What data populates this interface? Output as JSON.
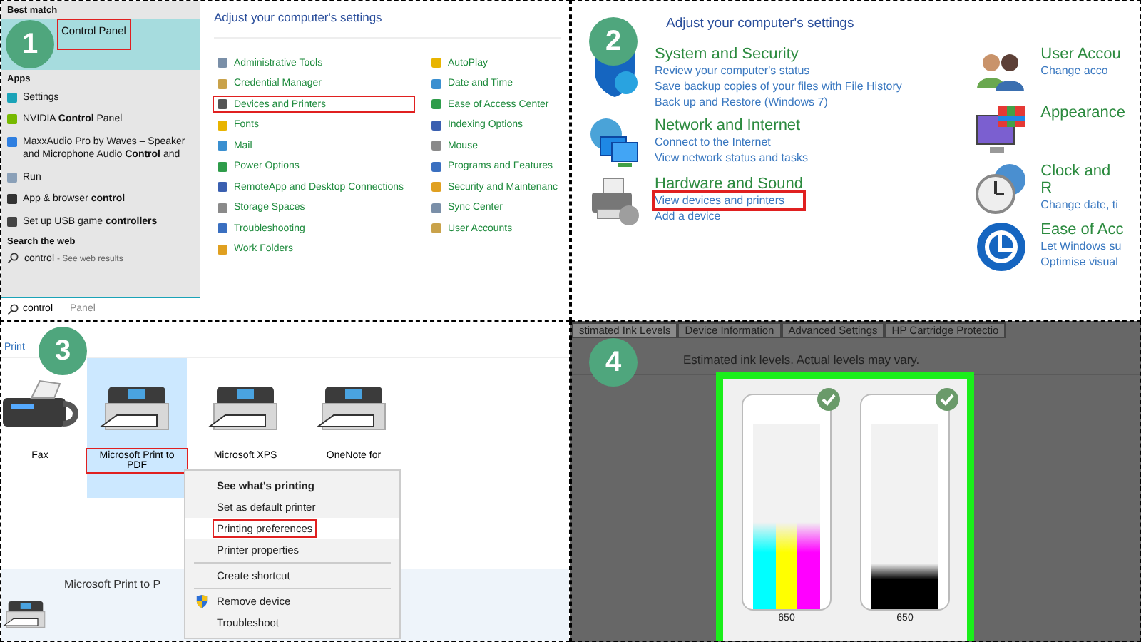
{
  "search_panel": {
    "step": "1",
    "best_match_heading": "Best match",
    "best_match": {
      "label": "Control Panel",
      "selected": true,
      "highlighted": true
    },
    "apps_heading": "Apps",
    "apps": [
      {
        "label": "Settings",
        "kind": "gear"
      },
      {
        "label": "NVIDIA **Control** Panel",
        "kind": "nvidia"
      },
      {
        "label": "MaxxAudio Pro by Waves – Speaker and Microphone Audio **Control** and",
        "kind": "audio"
      },
      {
        "label": "Run",
        "kind": "run"
      },
      {
        "label": "App & browser **control**",
        "kind": "shield"
      },
      {
        "label": "Set up USB game **controllers**",
        "kind": "gamepad"
      }
    ],
    "web_heading": "Search the web",
    "web_result": {
      "query": "control",
      "hint": "- See web results"
    },
    "search": {
      "value": "control",
      "suggestion": "Panel"
    }
  },
  "settings_panel": {
    "title": "Adjust your computer's settings",
    "columns": [
      {
        "items": [
          {
            "label": "Administrative Tools",
            "highlighted": false
          },
          {
            "label": "Credential Manager",
            "highlighted": false
          },
          {
            "label": "Devices and Printers",
            "highlighted": true
          },
          {
            "label": "Fonts",
            "highlighted": false
          },
          {
            "label": "Mail",
            "highlighted": false
          },
          {
            "label": "Power Options",
            "highlighted": false
          },
          {
            "label": "RemoteApp and Desktop Connections",
            "highlighted": false
          },
          {
            "label": "Storage Spaces",
            "highlighted": false
          },
          {
            "label": "Troubleshooting",
            "highlighted": false
          },
          {
            "label": "Work Folders",
            "highlighted": false
          }
        ]
      },
      {
        "items": [
          {
            "label": "AutoPlay",
            "highlighted": false
          },
          {
            "label": "Date and Time",
            "highlighted": false
          },
          {
            "label": "Ease of Access Center",
            "highlighted": false
          },
          {
            "label": "Indexing Options",
            "highlighted": false
          },
          {
            "label": "Mouse",
            "highlighted": false
          },
          {
            "label": "Programs and Features",
            "highlighted": false
          },
          {
            "label": "Security and Maintenanc",
            "highlighted": false
          },
          {
            "label": "Sync Center",
            "highlighted": false
          },
          {
            "label": "User Accounts",
            "highlighted": false
          }
        ]
      }
    ]
  },
  "category_panel": {
    "step": "2",
    "title": "Adjust your computer's settings",
    "columns": [
      {
        "categories": [
          {
            "kind": "security",
            "title": "System and Security",
            "links": [
              {
                "label": "Review your computer's status",
                "highlighted": false
              },
              {
                "label": "Save backup copies of your files with File History",
                "highlighted": false
              },
              {
                "label": "Back up and Restore (Windows 7)",
                "highlighted": false
              }
            ]
          },
          {
            "kind": "network",
            "title": "Network and Internet",
            "links": [
              {
                "label": "Connect to the Internet",
                "highlighted": false
              },
              {
                "label": "View network status and tasks",
                "highlighted": false
              }
            ]
          },
          {
            "kind": "hardware",
            "title": "Hardware and Sound",
            "links": [
              {
                "label": "View devices and printers",
                "highlighted": true
              },
              {
                "label": "Add a device",
                "highlighted": false
              }
            ]
          }
        ]
      },
      {
        "categories": [
          {
            "kind": "accounts",
            "title": "User Accou",
            "links": [
              {
                "label": "Change acco",
                "highlighted": false
              }
            ]
          },
          {
            "kind": "appearance",
            "title": "Appearance"
          },
          {
            "kind": "clock",
            "title": "Clock and R",
            "links": [
              {
                "label": "Change date, ti",
                "highlighted": false
              }
            ]
          },
          {
            "kind": "access",
            "title": "Ease of Acc",
            "links": [
              {
                "label": "Let Windows su",
                "highlighted": false
              },
              {
                "label": "Optimise visual",
                "highlighted": false
              }
            ]
          }
        ]
      }
    ]
  },
  "devices_panel": {
    "step": "3",
    "header": "Print",
    "devices": [
      {
        "label": "Fax",
        "kind": "fax",
        "selected": false,
        "highlighted": false
      },
      {
        "label": "Microsoft Print to PDF",
        "kind": "printer",
        "selected": true,
        "highlighted": true
      },
      {
        "label": "Microsoft XPS",
        "kind": "printer",
        "selected": false,
        "highlighted": false
      },
      {
        "label": "OneNote for",
        "kind": "printer",
        "selected": false,
        "highlighted": false
      }
    ],
    "menu": {
      "groups": [
        {
          "items": [
            {
              "label": "See what's printing",
              "kind": "plain",
              "bold": true,
              "selected": false,
              "highlighted": false
            },
            {
              "label": "Set as default printer",
              "kind": "plain",
              "bold": false,
              "selected": false,
              "highlighted": false
            },
            {
              "label": "Printing preferences",
              "kind": "plain",
              "bold": false,
              "selected": true,
              "highlighted": true
            },
            {
              "label": "Printer properties",
              "kind": "plain",
              "bold": false,
              "selected": false,
              "highlighted": false
            }
          ]
        },
        {
          "items": [
            {
              "label": "Create shortcut",
              "kind": "plain",
              "bold": false,
              "selected": false,
              "highlighted": false
            }
          ]
        },
        {
          "items": [
            {
              "label": "Remove device",
              "kind": "shield",
              "bold": false,
              "selected": false,
              "highlighted": false
            },
            {
              "label": "Troubleshoot",
              "kind": "plain",
              "bold": false,
              "selected": false,
              "highlighted": false
            }
          ]
        }
      ]
    },
    "details": {
      "label": "Microsoft Print to P"
    }
  },
  "ink_panel": {
    "step": "4",
    "tabs": [
      {
        "label": "stimated Ink Levels",
        "selected": true
      },
      {
        "label": "Device Information",
        "selected": false
      },
      {
        "label": "Advanced Settings",
        "selected": false
      },
      {
        "label": "HP Cartridge Protectio",
        "selected": false
      }
    ],
    "note": "Estimated ink levels.  Actual levels may vary.",
    "cartridges": [
      {
        "label": "650",
        "ok": true,
        "inks": [
          {
            "color": "#00ffff",
            "level": 0.47
          },
          {
            "color": "#ffff00",
            "level": 0.47
          },
          {
            "color": "#ff00ff",
            "level": 0.47
          }
        ]
      },
      {
        "label": "650",
        "ok": true,
        "inks": [
          {
            "color": "#000000",
            "level": 0.25
          }
        ]
      }
    ]
  }
}
